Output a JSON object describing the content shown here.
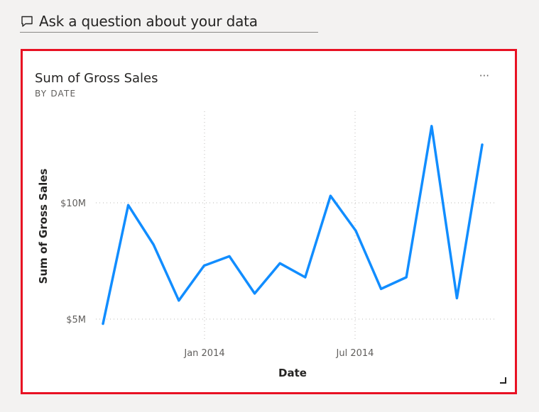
{
  "qa": {
    "placeholder": "Ask a question about your data",
    "icon": "speech-bubble-icon"
  },
  "tile": {
    "title": "Sum of Gross Sales",
    "subtitle": "BY DATE",
    "more_label": "···",
    "border_color": "#e81123"
  },
  "chart_data": {
    "type": "line",
    "title": "Sum of Gross Sales",
    "subtitle": "BY DATE",
    "xlabel": "Date",
    "ylabel": "Sum of Gross Sales",
    "x_ticks": [
      "Jan 2014",
      "Jul 2014"
    ],
    "y_ticks": [
      "$5M",
      "$10M"
    ],
    "ylim": [
      4.7,
      14.0
    ],
    "grid": true,
    "line_color": "#118dff",
    "series": [
      {
        "x": [
          "2013-09",
          "2013-10",
          "2013-11",
          "2013-12",
          "2014-01",
          "2014-02",
          "2014-03",
          "2014-04",
          "2014-05",
          "2014-06",
          "2014-07",
          "2014-08",
          "2014-09",
          "2014-10",
          "2014-11",
          "2014-12"
        ],
        "values": [
          4.8,
          9.9,
          8.2,
          5.8,
          7.3,
          7.7,
          6.1,
          7.4,
          6.8,
          10.3,
          8.8,
          6.3,
          6.8,
          13.3,
          5.9,
          12.5
        ]
      }
    ]
  }
}
